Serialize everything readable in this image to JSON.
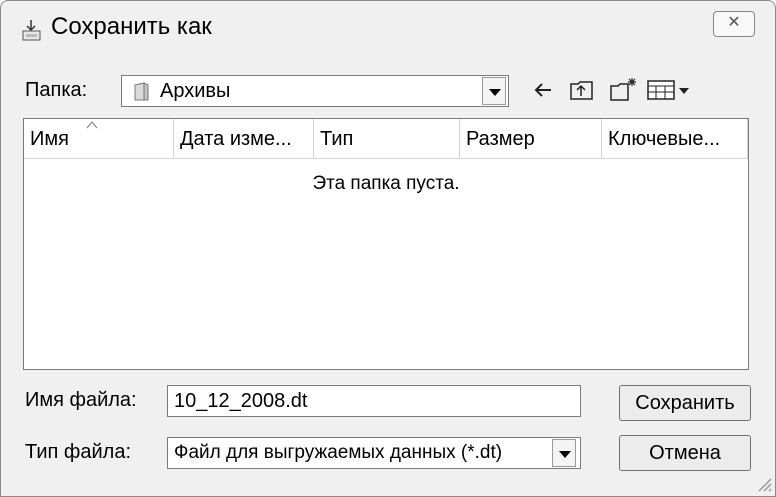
{
  "window": {
    "title": "Сохранить как",
    "close_symbol": "☒"
  },
  "location": {
    "label": "Папка:",
    "folder_name": "Архивы"
  },
  "toolbar": {
    "icons": [
      "back-arrow-icon",
      "up-folder-icon",
      "new-folder-icon",
      "view-menu-icon"
    ]
  },
  "file_list": {
    "columns": [
      "Имя",
      "Дата изме...",
      "Тип",
      "Размер",
      "Ключевые..."
    ],
    "sorted_column": "Имя",
    "empty_message": "Эта папка пуста."
  },
  "filename": {
    "label": "Имя файла:",
    "value": "10_12_2008.dt"
  },
  "filetype": {
    "label": "Тип файла:",
    "value": "Файл для выгружаемых данных (*.dt)"
  },
  "buttons": {
    "save": "Сохранить",
    "cancel": "Отмена"
  }
}
